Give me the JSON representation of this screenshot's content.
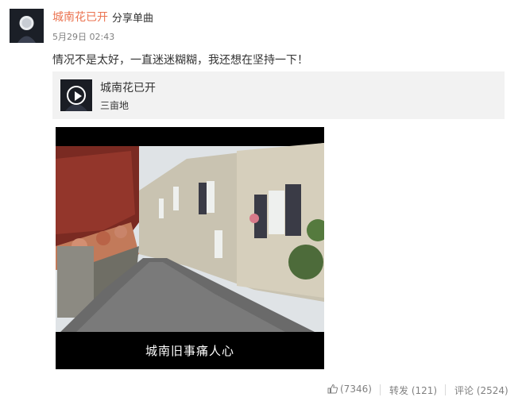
{
  "post": {
    "author": "城南花已开",
    "share_type": "分享单曲",
    "time": "5月29日 02:43",
    "text": "情况不是太好，一直迷迷糊糊，我还想在坚持一下！"
  },
  "music_card": {
    "title": "城南花已开",
    "artist": "三亩地",
    "icon": "play-circle-icon"
  },
  "video": {
    "subtitle": "城南旧事痛人心"
  },
  "actions": {
    "like": "(7346)",
    "repost": "转发 (121)",
    "comment": "评论 (2524)"
  },
  "colors": {
    "link": "#eb7350",
    "text": "#333333",
    "meta": "#808080",
    "card_bg": "#f2f2f2"
  }
}
